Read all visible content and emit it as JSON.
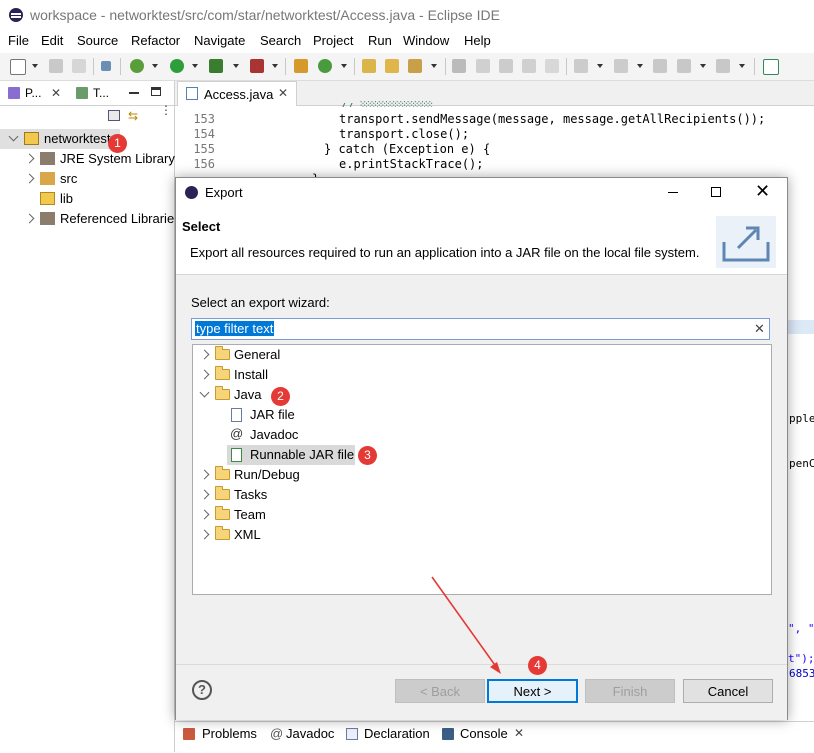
{
  "window": {
    "title": "workspace - networktest/src/com/star/networktest/Access.java - Eclipse IDE"
  },
  "menu": [
    "File",
    "Edit",
    "Source",
    "Refactor",
    "Navigate",
    "Search",
    "Project",
    "Run",
    "Window",
    "Help"
  ],
  "left_panel": {
    "tabs": [
      "P...",
      "T..."
    ],
    "tree": {
      "project": "networktest",
      "children": [
        "JRE System Library",
        "src",
        "lib",
        "Referenced Libraries"
      ]
    }
  },
  "editor": {
    "tab": "Access.java",
    "lines": [
      {
        "n": "153",
        "text": "transport.sendMessage(message, message.getAllRecipients());"
      },
      {
        "n": "154",
        "text": "transport.close();"
      },
      {
        "n": "155",
        "kw": "} catch (Exception e) {"
      },
      {
        "n": "156",
        "text": "e.printStackTrace();"
      }
    ],
    "right_edge_fragments": [
      "pplet",
      "penC",
      "\", \"",
      "t\");",
      "6853"
    ]
  },
  "bottom_views": [
    "Problems",
    "Javadoc",
    "Declaration",
    "Console"
  ],
  "dialog": {
    "title": "Export",
    "header_title": "Select",
    "header_desc": "Export all resources required to run an application into a JAR file on the local file system.",
    "wizard_label": "Select an export wizard:",
    "filter_placeholder": "type filter text",
    "tree": {
      "general": "General",
      "install": "Install",
      "java": "Java",
      "java_children": [
        "JAR file",
        "Javadoc",
        "Runnable JAR file"
      ],
      "rest": [
        "Run/Debug",
        "Tasks",
        "Team",
        "XML"
      ]
    },
    "buttons": {
      "help": "?",
      "back": "< Back",
      "next": "Next >",
      "finish": "Finish",
      "cancel": "Cancel"
    }
  },
  "annotations": [
    "1",
    "2",
    "3",
    "4"
  ],
  "colors": {
    "badge": "#e53935",
    "arrow": "#e53935",
    "selection": "#cce8ff",
    "keyword": "#7f0055"
  }
}
